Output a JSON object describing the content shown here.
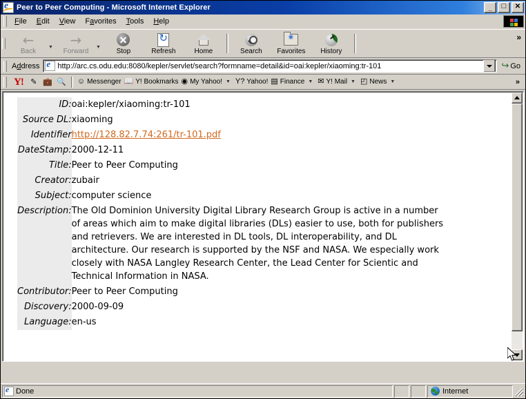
{
  "window": {
    "title": "Peer to Peer Computing - Microsoft Internet Explorer",
    "app_icon": "ie-document-icon",
    "minimize_label": "_",
    "maximize_label": "□",
    "close_label": "✕"
  },
  "menu": {
    "items": [
      {
        "label": "File",
        "accel": "F"
      },
      {
        "label": "Edit",
        "accel": "E"
      },
      {
        "label": "View",
        "accel": "V"
      },
      {
        "label": "Favorites",
        "accel": "a"
      },
      {
        "label": "Tools",
        "accel": "T"
      },
      {
        "label": "Help",
        "accel": "H"
      }
    ]
  },
  "toolbar": {
    "back_label": "Back",
    "forward_label": "Forward",
    "stop_label": "Stop",
    "refresh_label": "Refresh",
    "home_label": "Home",
    "search_label": "Search",
    "favorites_label": "Favorites",
    "history_label": "History",
    "overflow_label": "»",
    "back_enabled": false,
    "forward_enabled": false
  },
  "address": {
    "label": "Address",
    "url": "http://arc.cs.odu.edu:8080/kepler/servlet/search?formname=detail&id=oai:kepler/xiaoming:tr-101",
    "go_label": "Go",
    "go_arrow": "↪"
  },
  "yahoo_toolbar": {
    "logo": "Y!",
    "icons": [
      "pencil-icon",
      "briefcase-icon",
      "magnifier-icon"
    ],
    "items": [
      {
        "label": "Messenger",
        "glyph": "☺",
        "caret": false
      },
      {
        "label": "Y! Bookmarks",
        "glyph": "☷",
        "caret": true
      },
      {
        "label": "My Yahoo!",
        "glyph": "◉",
        "caret": true
      },
      {
        "label": "Yahoo!",
        "glyph": "Y?",
        "caret": true
      },
      {
        "label": "Finance",
        "glyph": "▤",
        "caret": true
      },
      {
        "label": "Y! Mail",
        "glyph": "✉",
        "caret": true
      },
      {
        "label": "News",
        "glyph": "◰",
        "caret": true
      }
    ],
    "overflow_label": "»"
  },
  "record": {
    "fields": [
      {
        "label": "ID:",
        "value": "oai:kepler/xiaoming:tr-101",
        "type": "text"
      },
      {
        "label": "Source DL:",
        "value": "xiaoming",
        "type": "text"
      },
      {
        "label": "Identifier",
        "value": "http://128.82.7.74:261/tr-101.pdf",
        "type": "link"
      },
      {
        "label": "DateStamp:",
        "value": "2000-12-11",
        "type": "text"
      },
      {
        "label": "Title:",
        "value": "Peer to Peer Computing",
        "type": "text"
      },
      {
        "label": "Creator:",
        "value": "zubair",
        "type": "text"
      },
      {
        "label": "Subject:",
        "value": "computer science",
        "type": "text"
      },
      {
        "label": "Description:",
        "value": "The Old Dominion University Digital Library Research Group is active in a number of areas which aim to make digital libraries (DLs) easier to use, both for publishers and retrievers. We are interested in DL tools, DL interoperability, and DL architecture. Our research is supported by the NSF and NASA. We especially work closely with NASA Langley Research Center, the Lead Center for Scientic and Technical Information in NASA.",
        "type": "text"
      },
      {
        "label": "Contributor:",
        "value": "Peer to Peer Computing",
        "type": "text"
      },
      {
        "label": "Discovery:",
        "value": "2000-09-09",
        "type": "text"
      },
      {
        "label": "Language:",
        "value": "en-us",
        "type": "text"
      }
    ],
    "link_color": "#d2691e"
  },
  "statusbar": {
    "status_text": "Done",
    "zone_text": "Internet"
  }
}
